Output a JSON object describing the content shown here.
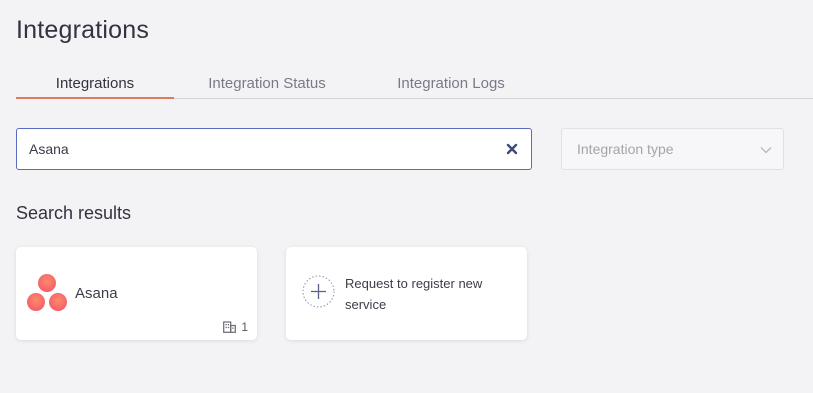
{
  "page": {
    "title": "Integrations"
  },
  "tabs": [
    {
      "label": "Integrations",
      "active": true
    },
    {
      "label": "Integration Status",
      "active": false
    },
    {
      "label": "Integration Logs",
      "active": false
    }
  ],
  "search": {
    "value": "Asana",
    "placeholder": ""
  },
  "filter": {
    "placeholder": "Integration type"
  },
  "results": {
    "title": "Search results",
    "items": [
      {
        "name": "Asana",
        "count": "1",
        "icon": "building-icon"
      }
    ],
    "request_label": "Request to register new service"
  },
  "colors": {
    "accent": "#e07a5f",
    "focus_border": "#5b6cc0",
    "asana_pink": "#f06a6a"
  }
}
